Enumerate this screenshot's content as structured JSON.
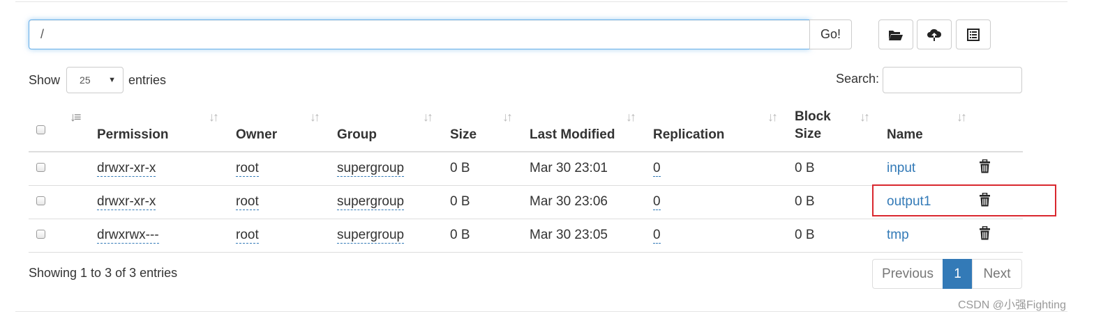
{
  "path_bar": {
    "value": "/",
    "go_label": "Go!"
  },
  "toolbar": {
    "icons": [
      "folder-open-icon",
      "cloud-upload-icon",
      "list-alt-icon"
    ]
  },
  "length": {
    "show_label": "Show",
    "selected": "25",
    "entries_label": "entries"
  },
  "search": {
    "label": "Search:",
    "value": ""
  },
  "table": {
    "headers": {
      "permission": "Permission",
      "owner": "Owner",
      "group": "Group",
      "size": "Size",
      "last_modified": "Last Modified",
      "replication": "Replication",
      "block_size_1": "Block",
      "block_size_2": "Size",
      "name": "Name"
    },
    "rows": [
      {
        "permission": "drwxr-xr-x",
        "owner": "root",
        "group": "supergroup",
        "size": "0 B",
        "last_modified": "Mar 30 23:01",
        "replication": "0",
        "block_size": "0 B",
        "name": "input"
      },
      {
        "permission": "drwxr-xr-x",
        "owner": "root",
        "group": "supergroup",
        "size": "0 B",
        "last_modified": "Mar 30 23:06",
        "replication": "0",
        "block_size": "0 B",
        "name": "output1"
      },
      {
        "permission": "drwxrwx---",
        "owner": "root",
        "group": "supergroup",
        "size": "0 B",
        "last_modified": "Mar 30 23:05",
        "replication": "0",
        "block_size": "0 B",
        "name": "tmp"
      }
    ]
  },
  "footer": {
    "info": "Showing 1 to 3 of 3 entries",
    "previous": "Previous",
    "current_page": "1",
    "next": "Next"
  },
  "watermark": "CSDN @小强Fighting",
  "colors": {
    "link": "#337ab7",
    "highlight": "#d9272e",
    "focus": "#66afe9"
  }
}
